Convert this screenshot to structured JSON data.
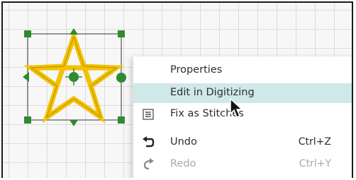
{
  "context_menu": {
    "items": [
      {
        "label": "Properties",
        "shortcut": "",
        "icon": "",
        "state": "normal"
      },
      {
        "label": "Edit in Digitizing",
        "shortcut": "",
        "icon": "",
        "state": "highlighted"
      },
      {
        "label": "Fix as Stitches",
        "shortcut": "",
        "icon": "fix-stitches-icon",
        "state": "normal"
      },
      {
        "label": "Undo",
        "shortcut": "Ctrl+Z",
        "icon": "undo-icon",
        "state": "normal"
      },
      {
        "label": "Redo",
        "shortcut": "Ctrl+Y",
        "icon": "redo-icon",
        "state": "disabled"
      }
    ]
  },
  "colors": {
    "highlight": "#cfe8e8",
    "star_fill": "#f2c200",
    "handles": "#2e8b2e",
    "grid": "#dcdcdc"
  },
  "canvas": {
    "selected_object": "star-shape",
    "cursor": "arrow-pointer"
  }
}
